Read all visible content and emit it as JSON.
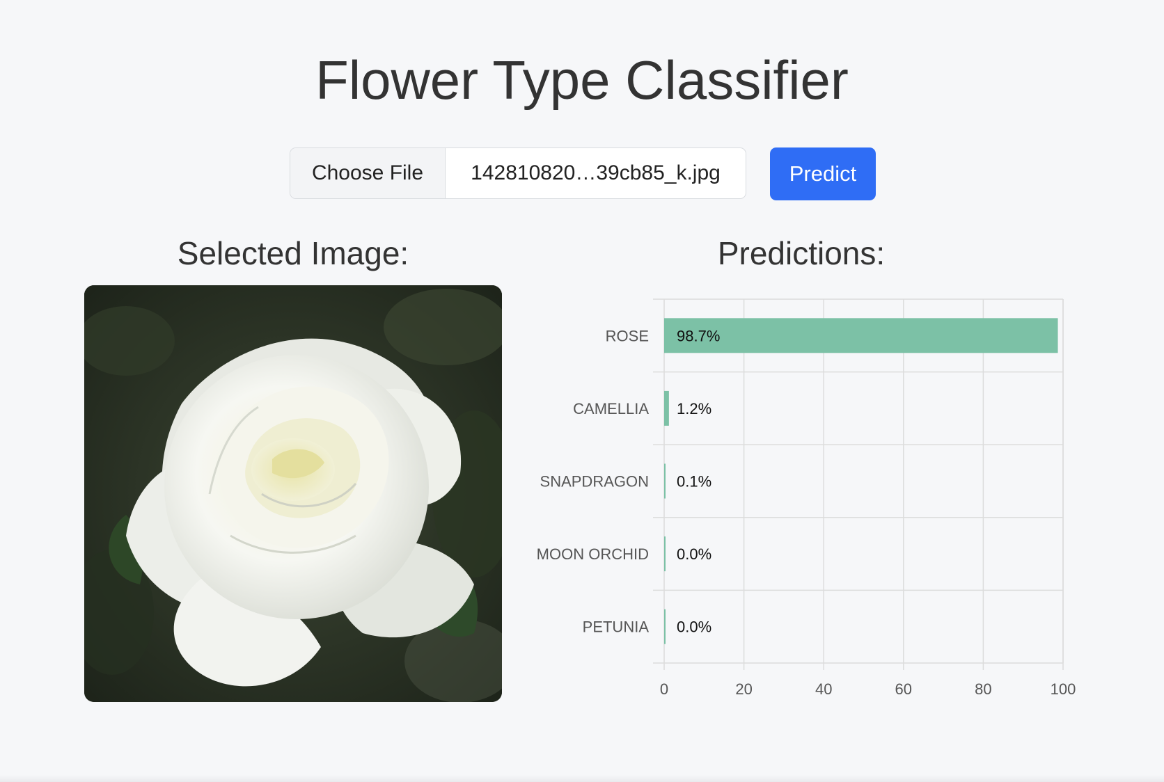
{
  "app": {
    "title": "Flower Type Classifier"
  },
  "upload": {
    "choose_file_label": "Choose File",
    "file_name": "142810820…39cb85_k.jpg",
    "predict_label": "Predict"
  },
  "sections": {
    "selected_image_heading": "Selected Image:",
    "predictions_heading": "Predictions:"
  },
  "image": {
    "subject": "white rose"
  },
  "chart_data": {
    "type": "bar",
    "orientation": "horizontal",
    "categories": [
      "ROSE",
      "CAMELLIA",
      "SNAPDRAGON",
      "MOON ORCHID",
      "PETUNIA"
    ],
    "values": [
      98.7,
      1.2,
      0.1,
      0.0,
      0.0
    ],
    "value_labels": [
      "98.7%",
      "1.2%",
      "0.1%",
      "0.0%",
      "0.0%"
    ],
    "xlim": [
      0,
      100
    ],
    "x_ticks": [
      0,
      20,
      40,
      60,
      80,
      100
    ],
    "grid": true,
    "bar_color": "#7cc1a6"
  }
}
